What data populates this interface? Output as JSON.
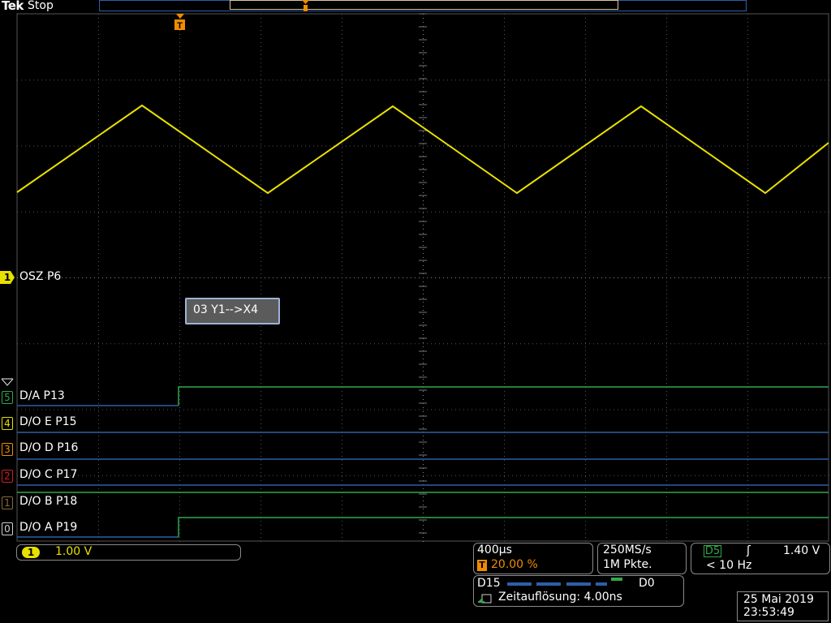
{
  "header": {
    "brand": "Tek",
    "state": "Stop"
  },
  "trigger_marker": "T",
  "analog": {
    "channel_number": "1",
    "label": "OSZ P6",
    "color": "#e8e000",
    "waveform": "triangle"
  },
  "bus": {
    "label": "03 Y1-->X4"
  },
  "digital": {
    "channels": [
      {
        "number": "5",
        "label": "D/A    P13",
        "color": "#2fa84a"
      },
      {
        "number": "4",
        "label": "D/O E P15",
        "color": "#e8e000"
      },
      {
        "number": "3",
        "label": "D/O D P16",
        "color": "#f08c00"
      },
      {
        "number": "2",
        "label": "D/O C P17",
        "color": "#d02020"
      },
      {
        "number": "1",
        "label": "D/O B P18",
        "color": "#8a6a3a"
      },
      {
        "number": "0",
        "label": "D/O A P19",
        "color": "#cfcfcf"
      }
    ],
    "high_color": "#2fa84a",
    "low_color": "#2d5fa8"
  },
  "readouts": {
    "ch_badge": "1",
    "ch_scale": "1.00 V",
    "time_per_div": "400µs",
    "trigger_icon": "T",
    "trigger_position": "20.00 %",
    "sample_rate": "250MS/s",
    "record_length": "1M Pkte.",
    "trigger_source": "D5",
    "trigger_edge": "ʃ",
    "trigger_level": "1.40 V",
    "trigger_freq": "< 10 Hz",
    "digital_high": "D15",
    "digital_low": "D0",
    "timing_resolution": "Zeitauflösung: 4.00ns",
    "date": "25 Mai  2019",
    "time": "23:53:49"
  }
}
